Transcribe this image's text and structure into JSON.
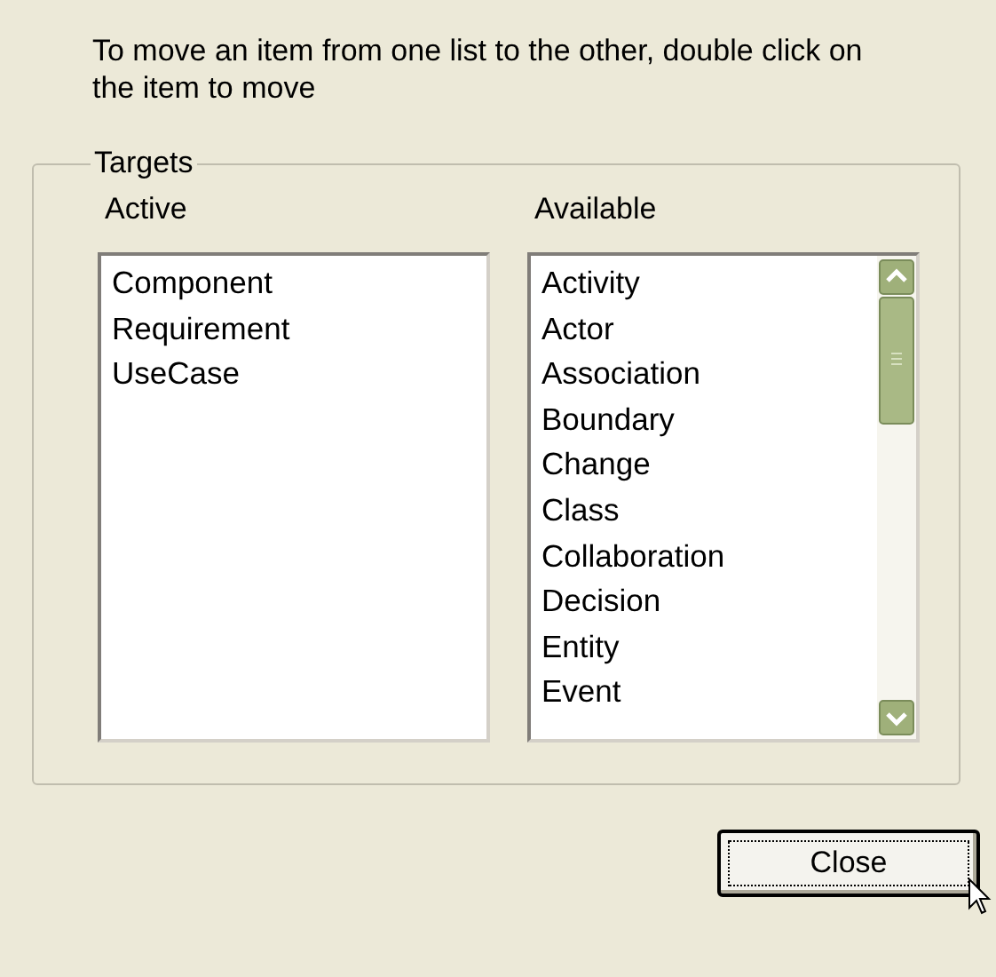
{
  "instruction": "To move an item from one list to the other, double click on the item to move",
  "group": {
    "title": "Targets",
    "lists": [
      {
        "label": "Active",
        "items": [
          "Component",
          "Requirement",
          "UseCase"
        ],
        "scrollbar": false
      },
      {
        "label": "Available",
        "items": [
          "Activity",
          "Actor",
          "Association",
          "Boundary",
          "Change",
          "Class",
          "Collaboration",
          "Decision",
          "Entity",
          "Event"
        ],
        "scrollbar": true
      }
    ]
  },
  "buttons": [
    {
      "label": "Close",
      "focused": true
    }
  ]
}
